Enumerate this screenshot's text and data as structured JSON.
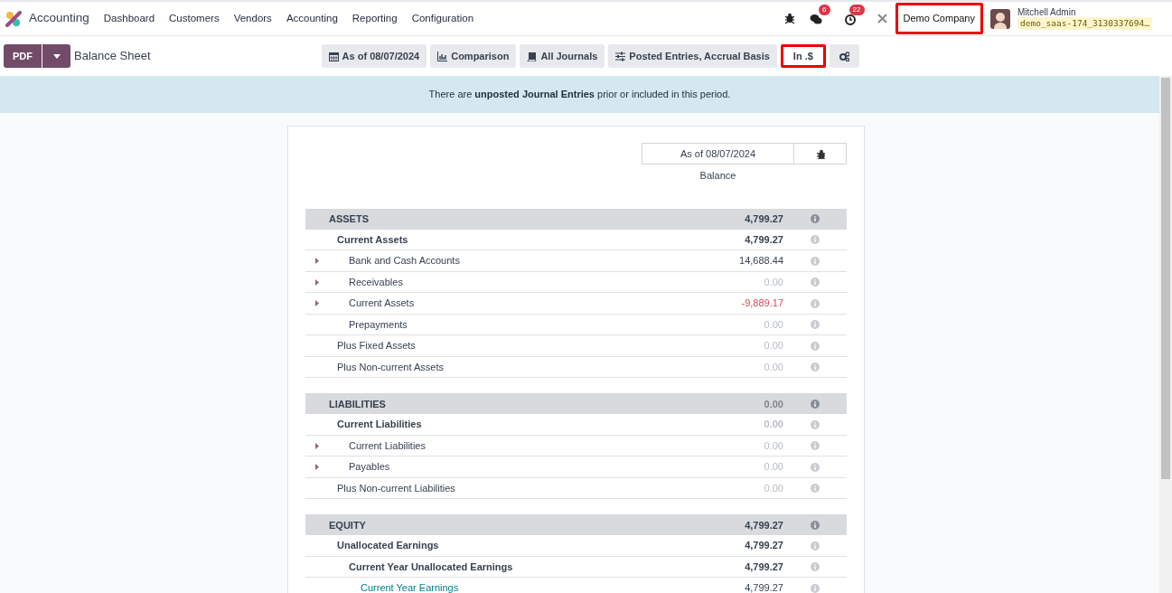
{
  "navbar": {
    "app_name": "Accounting",
    "menu": [
      "Dashboard",
      "Customers",
      "Vendors",
      "Accounting",
      "Reporting",
      "Configuration"
    ],
    "messages_count": "6",
    "activities_count": "22",
    "company": {
      "label": "Demo Company",
      "highlighted": true
    },
    "user": {
      "name": "Mitchell Admin",
      "database": "demo_saas-174_3130337694…"
    }
  },
  "control_panel": {
    "print_button": "PDF",
    "title": "Balance Sheet",
    "filters": [
      {
        "kind": "date",
        "label": "As of 08/07/2024",
        "highlighted": false
      },
      {
        "kind": "comparison",
        "label": "Comparison",
        "highlighted": false
      },
      {
        "kind": "journals",
        "label": "All Journals",
        "highlighted": false
      },
      {
        "kind": "options",
        "label": "Posted Entries, Accrual Basis",
        "highlighted": false
      },
      {
        "kind": "plain",
        "label": "In .$",
        "highlighted": true
      },
      {
        "kind": "settings",
        "highlighted": false
      }
    ]
  },
  "alert": "There are **unposted Journal Entries** prior or included in this period.",
  "report": {
    "column_header": "As of 08/07/2024",
    "column_subheader": "Balance",
    "sections": [
      {
        "label": "ASSETS",
        "value": "4,799.27",
        "muted": false,
        "negative": false,
        "children": [
          {
            "label": "Current Assets",
            "kind": "total",
            "value": "4,799.27",
            "muted": false,
            "negative": false,
            "expandable": false,
            "children": [
              {
                "label": "Bank and Cash Accounts",
                "kind": "line",
                "value": "14,688.44",
                "muted": false,
                "negative": false,
                "expandable": true
              },
              {
                "label": "Receivables",
                "kind": "line",
                "value": "0.00",
                "muted": true,
                "negative": false,
                "expandable": true
              },
              {
                "label": "Current Assets",
                "kind": "line",
                "value": "-9,889.17",
                "muted": false,
                "negative": true,
                "expandable": true
              },
              {
                "label": "Prepayments",
                "kind": "line",
                "value": "0.00",
                "muted": true,
                "negative": false,
                "expandable": false
              }
            ]
          },
          {
            "label": "Plus Fixed Assets",
            "kind": "line",
            "value": "0.00",
            "muted": true,
            "negative": false,
            "expandable": false
          },
          {
            "label": "Plus Non-current Assets",
            "kind": "line",
            "value": "0.00",
            "muted": true,
            "negative": false,
            "expandable": false
          }
        ]
      },
      {
        "label": "LIABILITIES",
        "value": "0.00",
        "muted": true,
        "negative": false,
        "children": [
          {
            "label": "Current Liabilities",
            "kind": "total",
            "value": "0.00",
            "muted": true,
            "negative": false,
            "expandable": false,
            "children": [
              {
                "label": "Current Liabilities",
                "kind": "line",
                "value": "0.00",
                "muted": true,
                "negative": false,
                "expandable": true
              },
              {
                "label": "Payables",
                "kind": "line",
                "value": "0.00",
                "muted": true,
                "negative": false,
                "expandable": true
              }
            ]
          },
          {
            "label": "Plus Non-current Liabilities",
            "kind": "line",
            "value": "0.00",
            "muted": true,
            "negative": false,
            "expandable": false
          }
        ]
      },
      {
        "label": "EQUITY",
        "value": "4,799.27",
        "muted": false,
        "negative": false,
        "children": [
          {
            "label": "Unallocated Earnings",
            "kind": "total",
            "value": "4,799.27",
            "muted": false,
            "negative": false,
            "expandable": false,
            "children": [
              {
                "label": "Current Year Unallocated Earnings",
                "kind": "total",
                "value": "4,799.27",
                "muted": false,
                "negative": false,
                "expandable": false,
                "children": [
                  {
                    "label": "Current Year Earnings",
                    "kind": "link",
                    "value": "4,799.27",
                    "muted": false,
                    "negative": false,
                    "expandable": false
                  }
                ]
              }
            ]
          }
        ]
      }
    ]
  }
}
